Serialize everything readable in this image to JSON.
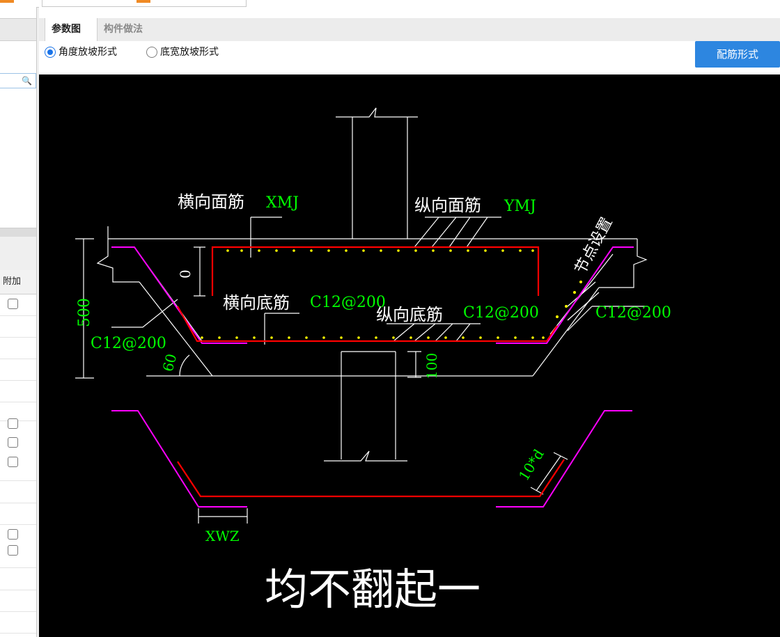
{
  "colors": {
    "accent": "#2d86e0",
    "rebar_red": "#ff0000",
    "magenta": "#ff00ff",
    "green_label": "#00ff00",
    "canvas_bg": "#000000"
  },
  "left_panel": {
    "column_header": "附加",
    "search_icon": "search-icon"
  },
  "tabs": [
    {
      "label": "参数图"
    },
    {
      "label": "构件做法"
    }
  ],
  "options": {
    "angle_slope": "角度放坡形式",
    "width_slope": "底宽放坡形式",
    "selected": "angle_slope",
    "rebar_button": "配筋形式"
  },
  "drawing": {
    "lbl_xmj_cn": "横向面筋",
    "lbl_xmj_code": "XMJ",
    "lbl_ymj_cn": "纵向面筋",
    "lbl_ymj_code": "YMJ",
    "lbl_node": "节点设置",
    "lbl_zero": "0",
    "lbl_500": "500",
    "lbl_c12_left": "C12@200",
    "lbl_hdj_cn": "横向底筋",
    "lbl_hdj_code": "C12@200",
    "lbl_zdj_cn": "纵向底筋",
    "lbl_zdj_code": "C12@200",
    "lbl_c12_right": "C12@200",
    "lbl_60": "60",
    "lbl_100": "100",
    "lbl_10d": "10*d",
    "lbl_xwz": "XWZ",
    "caption": "均不翻起一"
  }
}
